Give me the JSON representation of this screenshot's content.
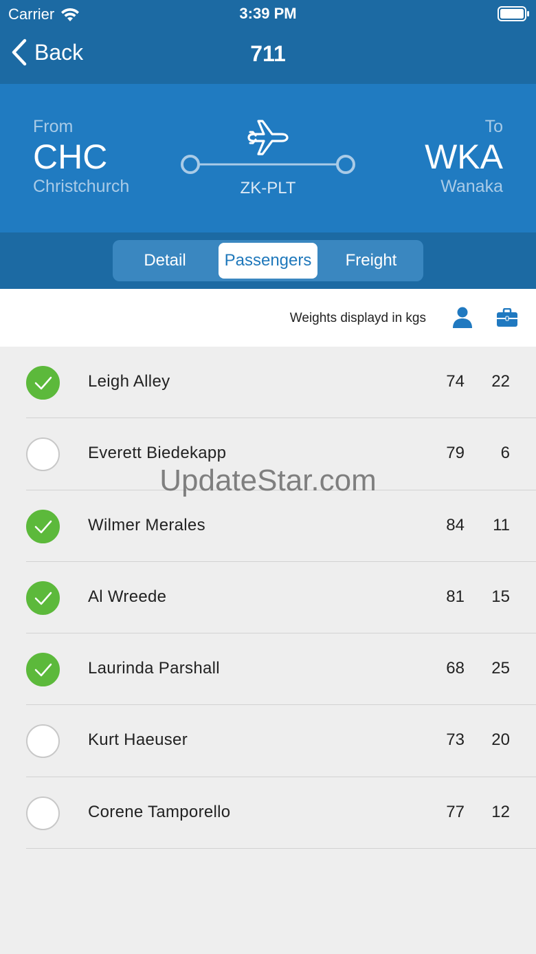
{
  "status": {
    "carrier": "Carrier",
    "time": "3:39 PM"
  },
  "nav": {
    "back_label": "Back",
    "title": "711"
  },
  "route": {
    "from_label": "From",
    "from_code": "CHC",
    "from_city": "Christchurch",
    "to_label": "To",
    "to_code": "WKA",
    "to_city": "Wanaka",
    "aircraft": "ZK-PLT"
  },
  "tabs": [
    {
      "label": "Detail",
      "active": false
    },
    {
      "label": "Passengers",
      "active": true
    },
    {
      "label": "Freight",
      "active": false
    }
  ],
  "weights_note": "Weights displayd in kgs",
  "passengers": [
    {
      "name": "Leigh Alley",
      "checked": true,
      "weight": "74",
      "bag": "22"
    },
    {
      "name": "Everett Biedekapp",
      "checked": false,
      "weight": "79",
      "bag": "6"
    },
    {
      "name": "Wilmer Merales",
      "checked": true,
      "weight": "84",
      "bag": "11"
    },
    {
      "name": "Al Wreede",
      "checked": true,
      "weight": "81",
      "bag": "15"
    },
    {
      "name": "Laurinda Parshall",
      "checked": true,
      "weight": "68",
      "bag": "25"
    },
    {
      "name": "Kurt Haeuser",
      "checked": false,
      "weight": "73",
      "bag": "20"
    },
    {
      "name": "Corene Tamporello",
      "checked": false,
      "weight": "77",
      "bag": "12"
    }
  ],
  "watermark": "UpdateStar.com",
  "colors": {
    "nav": "#1c6aa3",
    "route": "#207bc1",
    "check": "#5cb93b",
    "accent": "#1f78bb"
  }
}
